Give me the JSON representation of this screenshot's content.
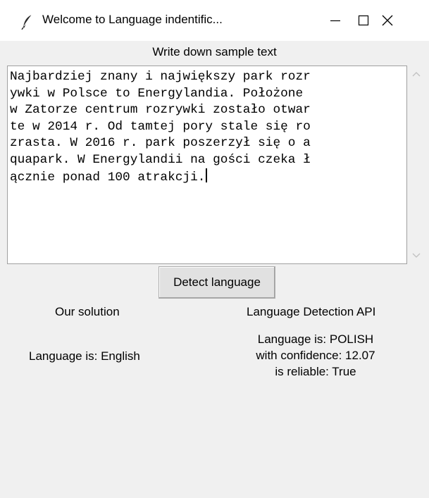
{
  "window": {
    "title": "Welcome to Language indentific...",
    "icon": "feather-icon",
    "controls": [
      "minimize-icon",
      "maximize-icon",
      "close-icon"
    ]
  },
  "input": {
    "label": "Write down sample text",
    "lines": [
      "Najbardziej znany i największy park rozr",
      "ywki w Polsce to Energylandia. Położone ",
      "w Zatorze centrum rozrywki zostało otwar",
      "te w 2014 r. Od tamtej pory stale się ro",
      "zrasta. W 2016 r. park poszerzył się o a",
      "quapark. W Energylandii na gości czeka ł",
      "ącznie ponad 100 atrakcji."
    ]
  },
  "detect_button": {
    "label": "Detect language"
  },
  "our_solution": {
    "heading": "Our solution",
    "result": "Language is: English"
  },
  "api": {
    "heading": "Language Detection API",
    "result_lines": [
      "Language is: POLISH",
      "with confidence: 12.07",
      "is reliable: True"
    ]
  }
}
